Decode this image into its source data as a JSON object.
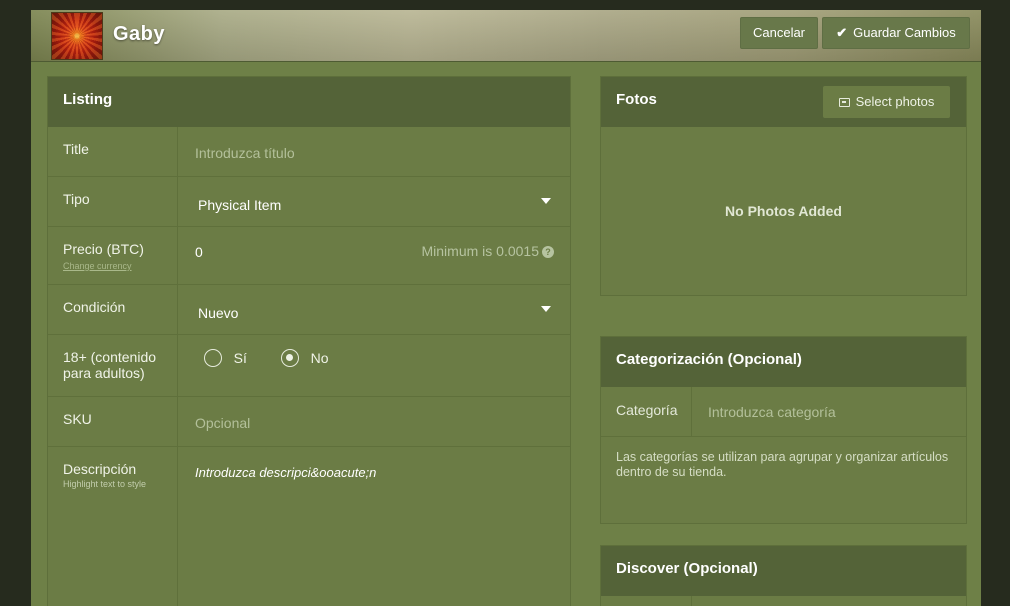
{
  "header": {
    "username": "Gaby",
    "cancel_label": "Cancelar",
    "save_label": "Guardar Cambios"
  },
  "listing": {
    "title": "Listing",
    "fields": {
      "title": {
        "label": "Title",
        "placeholder": "Introduzca título"
      },
      "type": {
        "label": "Tipo",
        "value": "Physical Item"
      },
      "price": {
        "label": "Precio (BTC)",
        "sub_link": "Change currency",
        "value": "0",
        "hint": "Minimum is 0.0015",
        "help_glyph": "?"
      },
      "condition": {
        "label": "Condición",
        "value": "Nuevo"
      },
      "adult": {
        "label": "18+ (contenido para adultos)",
        "options": [
          "Sí",
          "No"
        ],
        "selected": "No"
      },
      "sku": {
        "label": "SKU",
        "placeholder": "Opcional"
      },
      "description": {
        "label": "Descripción",
        "sub_hint": "Highlight text to style",
        "value": "Introduzca descripci&ooacute;n"
      }
    }
  },
  "photos": {
    "title": "Fotos",
    "select_label": "Select photos",
    "empty_text": "No Photos Added"
  },
  "categorization": {
    "title": "Categorización (Opcional)",
    "field_label": "Categoría",
    "placeholder": "Introduzca categoría",
    "help": "Las categorías se utilizan para agrupar y organizar artículos dentro de su tienda."
  },
  "discover": {
    "title": "Discover (Opcional)"
  }
}
